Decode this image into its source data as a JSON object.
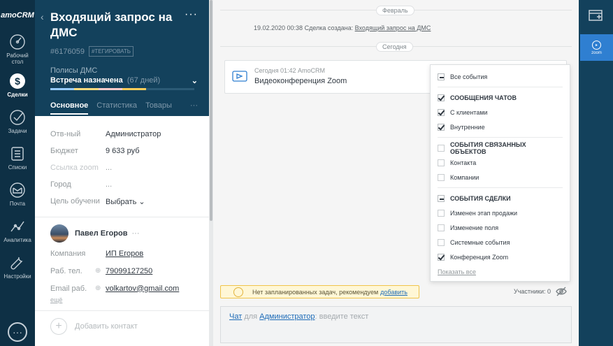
{
  "nav": {
    "logo": "amoCRM",
    "items": [
      {
        "label": "Рабочий стол",
        "icon": "dashboard-icon"
      },
      {
        "label": "Сделки",
        "icon": "deals-icon",
        "active": true
      },
      {
        "label": "Задачи",
        "icon": "tasks-icon"
      },
      {
        "label": "Списки",
        "icon": "lists-icon"
      },
      {
        "label": "Почта",
        "icon": "mail-icon"
      },
      {
        "label": "Аналитика",
        "icon": "analytics-icon"
      },
      {
        "label": "Настройки",
        "icon": "settings-icon"
      }
    ]
  },
  "card": {
    "title": "Входящий запрос на ДМС",
    "id": "#6176059",
    "tag_button": "#ТЕГИРОВАТЬ",
    "pipeline": "Полисы ДМС",
    "stage": "Встреча назначена",
    "stage_days": "(67 дней)",
    "tabs": [
      "Основное",
      "Статистика",
      "Товары"
    ],
    "tabs_more": "···",
    "fields": [
      {
        "label": "Отв-ный",
        "value": "Администратор"
      },
      {
        "label": "Бюджет",
        "value": "9 633 руб"
      },
      {
        "label": "Ссылка zoom",
        "value": "..."
      },
      {
        "label": "Город",
        "value": "..."
      },
      {
        "label": "Цель обучени",
        "value": "Выбрать"
      }
    ],
    "contact": {
      "name": "Павел Егоров",
      "company_label": "Компания",
      "company": "ИП Егоров",
      "phone_label": "Раб. тел.",
      "phone": "79099127250",
      "email_label": "Email раб.",
      "email": "volkartov@gmail.com",
      "more": "ещё"
    },
    "add_contact": "Добавить контакт"
  },
  "feed": {
    "month_label": "Февраль",
    "created_text": "19.02.2020 00:38 Сделка создана:",
    "created_link": "Входящий запрос на ДМС",
    "today_label": "Сегодня",
    "event_meta": "Сегодня 01:42 AmoCRM",
    "event_text": "Видеоконференция Zoom",
    "notice_text": "Нет запланированных задач, рекомендуем",
    "notice_link": "добавить",
    "participants": "Участники: 0",
    "composer": {
      "chat": "Чат",
      "for": "для",
      "user": "Администратор",
      "placeholder": ": введите текст"
    }
  },
  "filter": {
    "all": "Все события",
    "groups": [
      {
        "title": "СООБЩЕНИЯ ЧАТОВ",
        "state": "checked",
        "items": [
          {
            "label": "С клиентами",
            "checked": true
          },
          {
            "label": "Внутренние",
            "checked": true
          }
        ]
      },
      {
        "title": "СОБЫТИЯ СВЯЗАННЫХ ОБЪЕКТОВ",
        "state": "none",
        "items": [
          {
            "label": "Контакта",
            "checked": false
          },
          {
            "label": "Компании",
            "checked": false
          }
        ]
      },
      {
        "title": "СОБЫТИЯ СДЕЛКИ",
        "state": "partial",
        "items": [
          {
            "label": "Изменен этап продажи",
            "checked": false
          },
          {
            "label": "Изменение поля",
            "checked": false
          },
          {
            "label": "Системные события",
            "checked": false
          },
          {
            "label": "Конференция Zoom",
            "checked": true
          }
        ]
      }
    ],
    "show_all": "Показать все"
  },
  "rail": {
    "zoom_label": "zoom"
  },
  "colors": {
    "nav_bg": "#0e3045",
    "card_head": "#13415c",
    "accent": "#2f7fd1",
    "progress": [
      "#99ccff",
      "#ffdc7f",
      "#ffcccc",
      "#ffce5a",
      "#13415c"
    ]
  }
}
